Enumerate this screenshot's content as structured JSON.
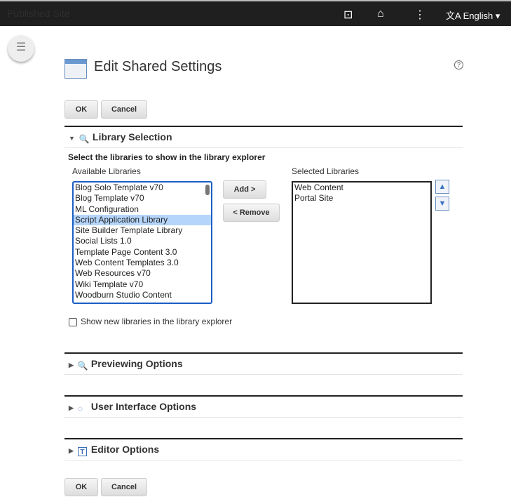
{
  "topbar": {
    "site_name": "Published Site",
    "icons": [
      "panel-toggle-icon",
      "home-icon",
      "more-vertical-icon",
      "translate-icon"
    ],
    "language": "English"
  },
  "page": {
    "title": "Edit Shared Settings",
    "help": "?"
  },
  "buttons": {
    "ok": "OK",
    "cancel": "Cancel",
    "add": "Add >",
    "remove": "< Remove"
  },
  "library_selection": {
    "header": "Library Selection",
    "expanded": true,
    "instruction": "Select the libraries to show in the library explorer",
    "available_label": "Available Libraries",
    "available": [
      "Blog Solo Template v70",
      "Blog Template v70",
      "ML Configuration",
      "Script Application Library",
      "Site Builder Template Library",
      "Social Lists 1.0",
      "Template Page Content 3.0",
      "Web Content Templates 3.0",
      "Web Resources v70",
      "Wiki Template v70",
      "Woodburn Studio Content"
    ],
    "selected_available": "Script Application Library",
    "selected_label": "Selected Libraries",
    "selected": [
      "Web Content",
      "Portal Site"
    ],
    "checkbox_label": "Show new libraries in the library explorer",
    "checkbox_checked": false
  },
  "sections": [
    {
      "header": "Previewing Options"
    },
    {
      "header": "User Interface Options"
    },
    {
      "header": "Editor Options"
    }
  ]
}
